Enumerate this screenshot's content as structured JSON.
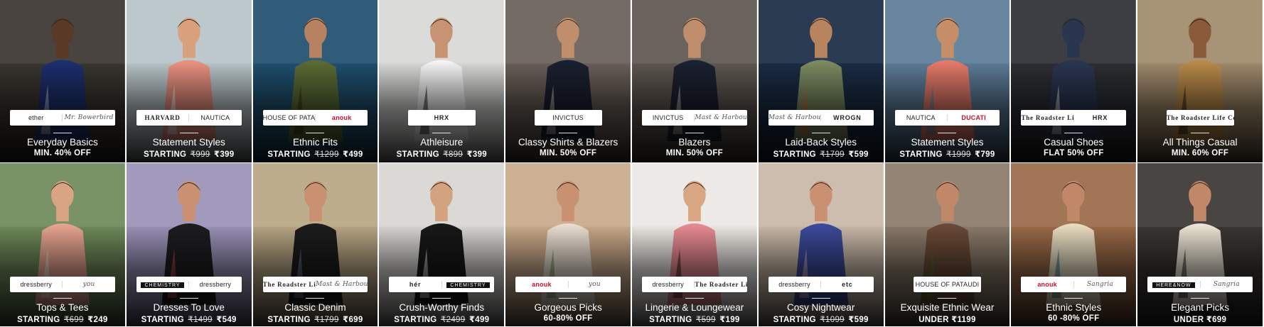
{
  "tiles": [
    {
      "title": "Everyday Basics",
      "offer_prefix": "MIN. 40% OFF",
      "mrp": "",
      "price": "",
      "brands": [
        {
          "text": "ether",
          "style": ""
        },
        {
          "text": "Mr. Bowerbird",
          "style": "script"
        }
      ],
      "bg": "#3a3530",
      "fg": "#1d2f6e",
      "skin": "#5a3a26",
      "accent": "#c9d4e8"
    },
    {
      "title": "Statement Styles",
      "offer_prefix": "STARTING",
      "mrp": "₹999",
      "price": "₹399",
      "brands": [
        {
          "text": "HARVARD",
          "style": "bold serif"
        },
        {
          "text": "NAUTICA",
          "style": ""
        }
      ],
      "bg": "#b8c4c8",
      "fg": "#e8917f",
      "skin": "#d8a07c",
      "accent": "#ffffff"
    },
    {
      "title": "Ethnic Fits",
      "offer_prefix": "STARTING",
      "mrp": "₹1299",
      "price": "₹499",
      "brands": [
        {
          "text": "HOUSE OF PATAUDI",
          "style": ""
        },
        {
          "text": "anouk",
          "style": "red"
        }
      ],
      "bg": "#1f4f6e",
      "fg": "#5a6b35",
      "skin": "#b78261",
      "accent": "#3d2a1a"
    },
    {
      "title": "Athleisure",
      "offer_prefix": "STARTING",
      "mrp": "₹899",
      "price": "₹399",
      "brands": [
        {
          "text": "HRX",
          "style": "bold"
        }
      ],
      "bg": "#d8d8d6",
      "fg": "#f4f4f4",
      "skin": "#c89373",
      "accent": "#1b1b1b"
    },
    {
      "title": "Classy Shirts & Blazers",
      "offer_prefix": "MIN. 50% OFF",
      "mrp": "",
      "price": "",
      "brands": [
        {
          "text": "INVICTUS",
          "style": ""
        }
      ],
      "bg": "#6a5f58",
      "fg": "#1b2030",
      "skin": "#c08e6d",
      "accent": "#d8cfc2"
    },
    {
      "title": "Blazers",
      "offer_prefix": "MIN. 50% OFF",
      "mrp": "",
      "price": "",
      "brands": [
        {
          "text": "INVICTUS",
          "style": ""
        },
        {
          "text": "Mast & Harbour",
          "style": "script"
        }
      ],
      "bg": "#5e5650",
      "fg": "#1c2130",
      "skin": "#c08e6d",
      "accent": "#d8cfc2"
    },
    {
      "title": "Laid-Back Styles",
      "offer_prefix": "STARTING",
      "mrp": "₹1799",
      "price": "₹599",
      "brands": [
        {
          "text": "Mast & Harbour",
          "style": "script"
        },
        {
          "text": "WROGN",
          "style": "bold"
        }
      ],
      "bg": "#1a2c44",
      "fg": "#7c8b62",
      "skin": "#b8835f",
      "accent": "#d2682a"
    },
    {
      "title": "Statement Styles",
      "offer_prefix": "STARTING",
      "mrp": "₹1999",
      "price": "₹799",
      "brands": [
        {
          "text": "NAUTICA",
          "style": ""
        },
        {
          "text": "DUCATI",
          "style": "red"
        }
      ],
      "bg": "#5c7c98",
      "fg": "#e47a6a",
      "skin": "#c58d68",
      "accent": "#4a8aa8"
    },
    {
      "title": "Casual Shoes",
      "offer_prefix": "FLAT 50% OFF",
      "mrp": "",
      "price": "",
      "brands": [
        {
          "text": "The Roadster Life Co.",
          "style": "bold serif"
        },
        {
          "text": "HRX",
          "style": "bold"
        }
      ],
      "bg": "#2c2e33",
      "fg": "#2a3550",
      "skin": "#2a3550",
      "accent": "#e8e8e8"
    },
    {
      "title": "All Things Casual",
      "offer_prefix": "MIN. 60% OFF",
      "mrp": "",
      "price": "",
      "brands": [
        {
          "text": "The Roadster Life Co.",
          "style": "bold serif"
        }
      ],
      "bg": "#a08a6a",
      "fg": "#b98a4a",
      "skin": "#8a5a3a",
      "accent": "#2a1f18"
    },
    {
      "title": "Tops & Tees",
      "offer_prefix": "STARTING",
      "mrp": "₹699",
      "price": "₹249",
      "brands": [
        {
          "text": "dressberry",
          "style": ""
        },
        {
          "text": "you",
          "style": "script"
        }
      ],
      "bg": "#6e8a5a",
      "fg": "#e7a490",
      "skin": "#d7a582",
      "accent": "#f2e8d8"
    },
    {
      "title": "Dresses To Love",
      "offer_prefix": "STARTING",
      "mrp": "₹1499",
      "price": "₹549",
      "brands": [
        {
          "text": "CHEMISTRY",
          "style": "inv"
        },
        {
          "text": "dressberry",
          "style": ""
        }
      ],
      "bg": "#9a92b8",
      "fg": "#1d1d20",
      "skin": "#c99072",
      "accent": "#d44a5a"
    },
    {
      "title": "Classic Denim",
      "offer_prefix": "STARTING",
      "mrp": "₹1799",
      "price": "₹699",
      "brands": [
        {
          "text": "The Roadster Life Co.",
          "style": "bold serif"
        },
        {
          "text": "Mast & Harbour",
          "style": "script"
        }
      ],
      "bg": "#b8a684",
      "fg": "#1c1c1c",
      "skin": "#c99072",
      "accent": "#6a85a8"
    },
    {
      "title": "Crush-Worthy Finds",
      "offer_prefix": "STARTING",
      "mrp": "₹2499",
      "price": "₹499",
      "brands": [
        {
          "text": "hér",
          "style": "bold"
        },
        {
          "text": "CHEMISTRY",
          "style": "inv"
        }
      ],
      "bg": "#d8d6d2",
      "fg": "#181818",
      "skin": "#d3a27f",
      "accent": "#f4f4f4"
    },
    {
      "title": "Gorgeous Picks",
      "offer_prefix": "60-80% OFF",
      "mrp": "",
      "price": "",
      "brands": [
        {
          "text": "anouk",
          "style": "red"
        },
        {
          "text": "you",
          "style": "script"
        }
      ],
      "bg": "#c9a98a",
      "fg": "#e8ddd0",
      "skin": "#c99072",
      "accent": "#6b8a4a"
    },
    {
      "title": "Lingerie & Loungewear",
      "offer_prefix": "STARTING",
      "mrp": "₹599",
      "price": "₹199",
      "brands": [
        {
          "text": "dressberry",
          "style": ""
        },
        {
          "text": "The Roadster Life Co.",
          "style": "bold serif"
        }
      ],
      "bg": "#ece8e4",
      "fg": "#e88a92",
      "skin": "#d9a683",
      "accent": "#2a1a16"
    },
    {
      "title": "Cosy Nightwear",
      "offer_prefix": "STARTING",
      "mrp": "₹1099",
      "price": "₹599",
      "brands": [
        {
          "text": "dressberry",
          "style": ""
        },
        {
          "text": "etc",
          "style": "bold"
        }
      ],
      "bg": "#c9b8a8",
      "fg": "#3b4a9a",
      "skin": "#c99072",
      "accent": "#e8b4c8"
    },
    {
      "title": "Exquisite Ethnic Wear",
      "offer_prefix": "UNDER",
      "mrp": "",
      "price": "₹1199",
      "brands": [
        {
          "text": "HOUSE OF PATAUDI",
          "style": ""
        }
      ],
      "bg": "#8a7a6a",
      "fg": "#6a4a36",
      "skin": "#c08868",
      "accent": "#4a6a3a"
    },
    {
      "title": "Ethnic Styles",
      "offer_prefix": "60 -80% OFF",
      "mrp": "",
      "price": "",
      "brands": [
        {
          "text": "anouk",
          "style": "red"
        },
        {
          "text": "Sangria",
          "style": "script"
        }
      ],
      "bg": "#9a6a48",
      "fg": "#e8dcc0",
      "skin": "#c08868",
      "accent": "#2a6a8a"
    },
    {
      "title": "Elegant Picks",
      "offer_prefix": "UNDER",
      "mrp": "",
      "price": "₹699",
      "brands": [
        {
          "text": "HERE&NOW",
          "style": "inv"
        },
        {
          "text": "Sangria",
          "style": "script"
        }
      ],
      "bg": "#3a3634",
      "fg": "#ece4d4",
      "skin": "#c08868",
      "accent": "#1a1a1a"
    }
  ]
}
